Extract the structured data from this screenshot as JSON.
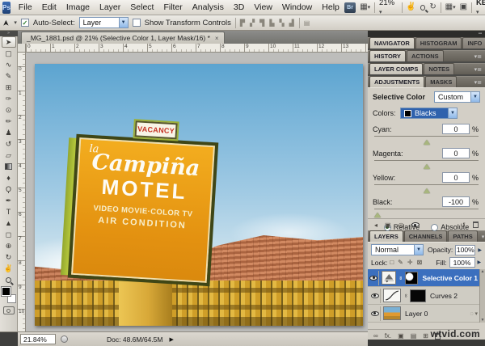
{
  "app": {
    "logo": "Ps",
    "menu_items": [
      "File",
      "Edit",
      "Image",
      "Layer",
      "Select",
      "Filter",
      "Analysis",
      "3D",
      "View",
      "Window",
      "Help"
    ],
    "bridge_label": "Br",
    "zoom_level": "21%",
    "workspace_label": "KEN"
  },
  "options": {
    "auto_select": "Auto-Select:",
    "auto_select_mode": "Layer",
    "show_transform": "Show Transform Controls"
  },
  "doc": {
    "tab": "_MG_1881.psd @ 21% (Selective Color 1, Layer Mask/16) *",
    "zoom_status": "21.84%",
    "doc_size": "Doc: 48.6M/64.5M",
    "h_ruler": [
      "0",
      "1",
      "2",
      "3",
      "4",
      "5",
      "6",
      "7",
      "8",
      "9",
      "10",
      "11",
      "12",
      "13"
    ],
    "v_ruler": [
      "0",
      "1",
      "2",
      "3",
      "4",
      "5",
      "6",
      "7",
      "8",
      "9",
      "10"
    ]
  },
  "photo": {
    "vacancy": "VACANCY",
    "sign_la": "la",
    "sign_name": "Campiña",
    "sign_motel": "MOTEL",
    "sign_line1": "VIDEO MOVIE·COLOR TV",
    "sign_line2": "AIR CONDITION"
  },
  "dock": {
    "groups": {
      "g1": [
        "NAVIGATOR",
        "HISTOGRAM",
        "INFO"
      ],
      "g2": [
        "HISTORY",
        "ACTIONS"
      ],
      "g3": [
        "LAYER COMPS",
        "NOTES"
      ],
      "g4": [
        "ADJUSTMENTS",
        "MASKS"
      ],
      "g5": [
        "LAYERS",
        "CHANNELS",
        "PATHS"
      ]
    },
    "adjustments": {
      "title": "Selective Color",
      "preset": "Custom",
      "colors_label": "Colors:",
      "colors_value": "Blacks",
      "sliders": [
        {
          "label": "Cyan:",
          "value": "0",
          "unit": "%"
        },
        {
          "label": "Magenta:",
          "value": "0",
          "unit": "%"
        },
        {
          "label": "Yellow:",
          "value": "0",
          "unit": "%"
        },
        {
          "label": "Black:",
          "value": "-100",
          "unit": "%"
        }
      ],
      "relative": "Relative",
      "absolute": "Absolute"
    },
    "layers": {
      "blend_mode": "Normal",
      "opacity_label": "Opacity:",
      "opacity_value": "100%",
      "lock_label": "Lock:",
      "fill_label": "Fill:",
      "fill_value": "100%",
      "fx_label": "fx.",
      "items": [
        {
          "name": "Selective Color 1"
        },
        {
          "name": "Curves 2"
        },
        {
          "name": "Layer 0"
        }
      ]
    }
  },
  "watermark": "wtvid.com",
  "colors": {
    "selection_blue": "#3b6fbe",
    "dropdown_highlight": "#2f62ad",
    "sign_orange": "#e89a18"
  }
}
